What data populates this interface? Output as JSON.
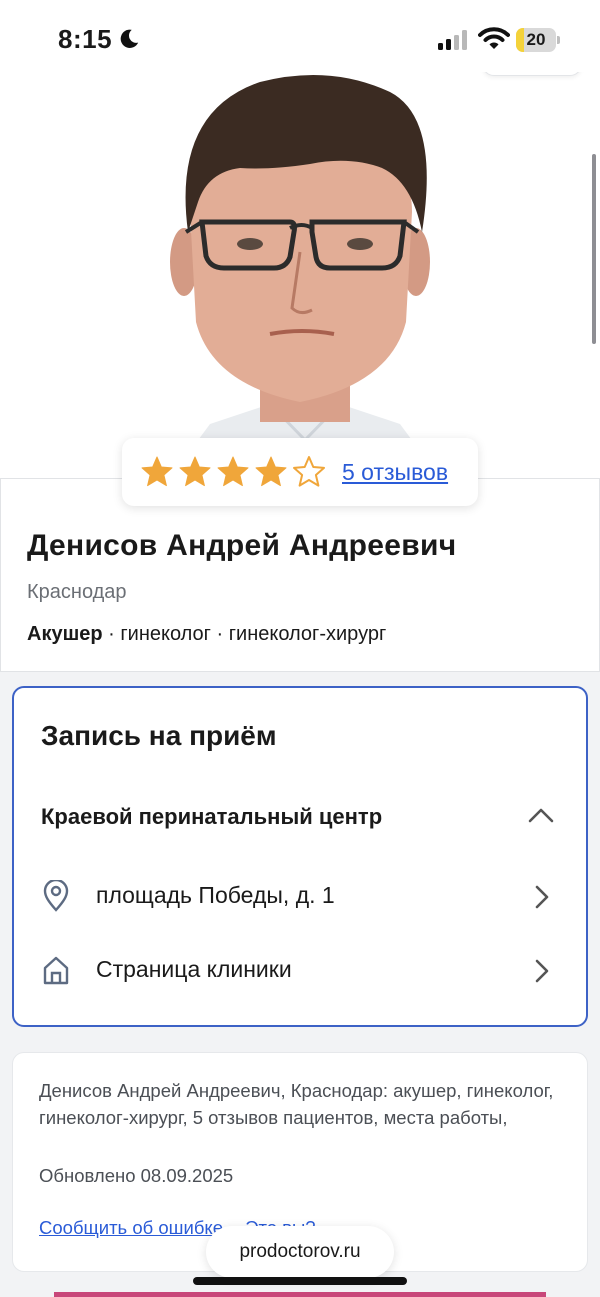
{
  "status_bar": {
    "time": "8:15",
    "battery_percent": "20",
    "battery_level": 0.2,
    "battery_color": "#f4d23a"
  },
  "doctor": {
    "rating": 4,
    "rating_max": 5,
    "reviews_link": "5 отзывов",
    "name": "Денисов Андрей Андреевич",
    "city": "Краснодар",
    "specialty_main": "Акушер",
    "specialty_rest": " · гинеколог · гинеколог-хирург"
  },
  "appointment": {
    "title": "Запись на приём",
    "clinic_name": "Краевой перинатальный центр",
    "address": "площадь Победы, д. 1",
    "clinic_page": "Страница клиники",
    "border_color": "#3d62c6"
  },
  "info": {
    "description": "Денисов Андрей Андреевич, Краснодар: акушер, гинеколог, гинеколог-хирург, 5 отзывов пациентов, места работы,",
    "updated": "Обновлено 08.09.2025",
    "report_error_link": "Сообщить об ошибке",
    "is_it_you_link": "Это вы?"
  },
  "browser": {
    "url": "prodoctorov.ru"
  },
  "colors": {
    "link": "#2a5bd7",
    "star": "#f0a63a"
  },
  "icons": [
    "moon-icon",
    "signal-icon",
    "wifi-icon",
    "star-icon",
    "chevron-up-icon",
    "location-pin-icon",
    "home-icon",
    "chevron-right-icon"
  ]
}
